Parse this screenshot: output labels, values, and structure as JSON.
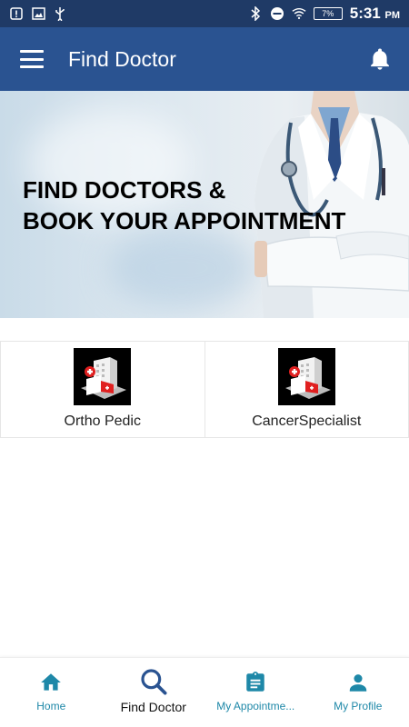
{
  "status_bar": {
    "time": "5:31",
    "ampm": "PM",
    "battery": "7%"
  },
  "app_bar": {
    "title": "Find Doctor"
  },
  "hero": {
    "line1": "FIND DOCTORS &",
    "line2": "BOOK YOUR APPOINTMENT"
  },
  "categories": [
    {
      "label": "Ortho Pedic",
      "icon": "hospital-icon"
    },
    {
      "label": "CancerSpecialist",
      "icon": "hospital-icon"
    }
  ],
  "bottom_nav": [
    {
      "label": "Home",
      "icon": "home-icon"
    },
    {
      "label": "Find Doctor",
      "icon": "search-icon",
      "active": true
    },
    {
      "label": "My Appointme...",
      "icon": "clipboard-icon"
    },
    {
      "label": "My Profile",
      "icon": "person-icon"
    }
  ],
  "colors": {
    "status_bar": "#1f3a66",
    "app_bar": "#2a5391",
    "nav_accent": "#1e88a8"
  }
}
